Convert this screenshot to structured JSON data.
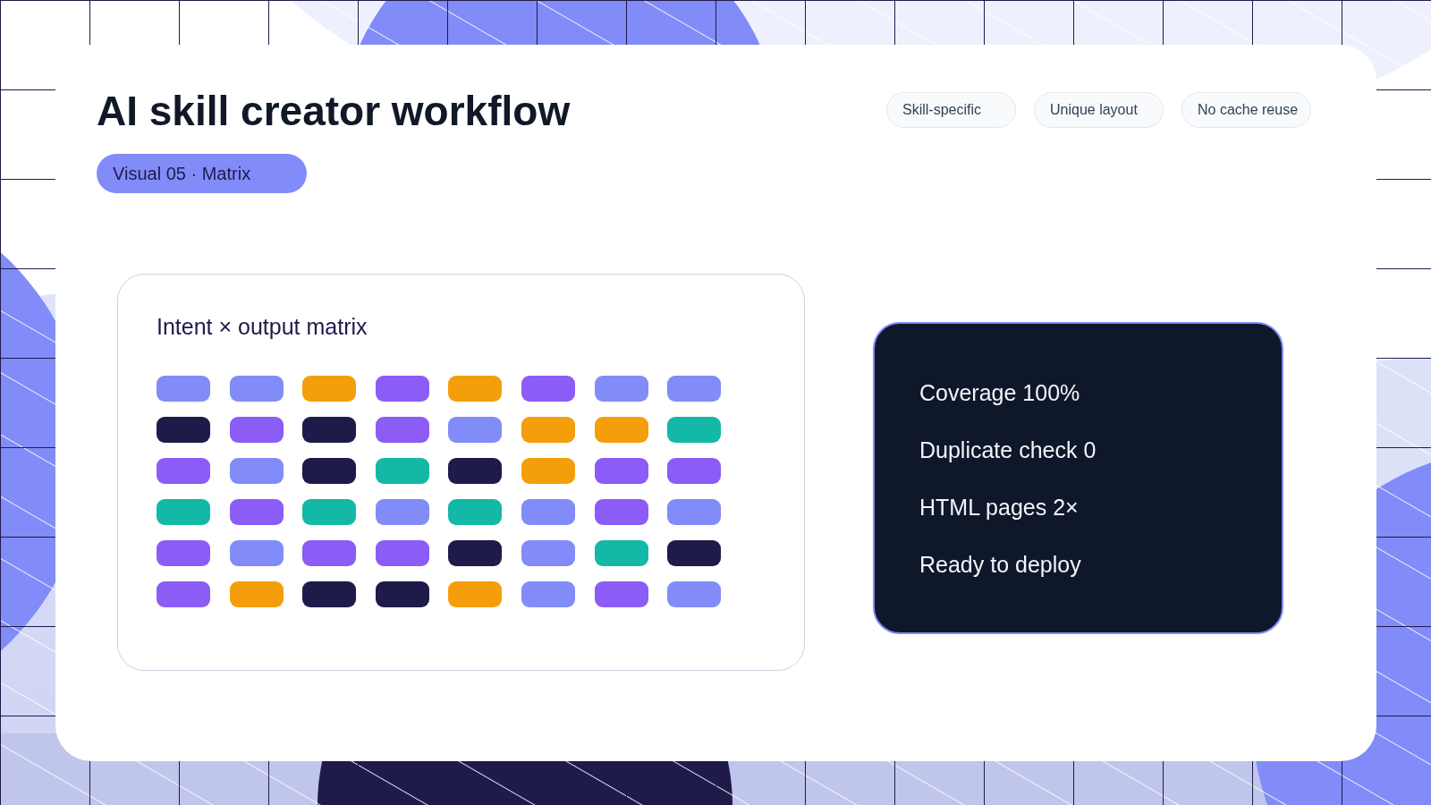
{
  "title": "AI skill creator workflow",
  "badge": "Visual 05 · Matrix",
  "tags": [
    "Skill-specific",
    "Unique layout",
    "No cache reuse"
  ],
  "matrix": {
    "title": "Intent × output matrix",
    "rows": [
      {
        "cells": [
          {
            "color": "#818cf8"
          },
          {
            "color": "#818cf8"
          },
          {
            "color": "#f59e0b"
          },
          {
            "color": "#8b5cf6"
          },
          {
            "color": "#f59e0b"
          },
          {
            "color": "#8b5cf6"
          },
          {
            "color": "#818cf8"
          },
          {
            "color": "#818cf8"
          }
        ]
      },
      {
        "cells": [
          {
            "color": "#1e1b4b"
          },
          {
            "color": "#8b5cf6"
          },
          {
            "color": "#1e1b4b"
          },
          {
            "color": "#8b5cf6"
          },
          {
            "color": "#818cf8"
          },
          {
            "color": "#f59e0b"
          },
          {
            "color": "#f59e0b"
          },
          {
            "color": "#14b8a6"
          }
        ]
      },
      {
        "cells": [
          {
            "color": "#8b5cf6"
          },
          {
            "color": "#818cf8"
          },
          {
            "color": "#1e1b4b"
          },
          {
            "color": "#14b8a6"
          },
          {
            "color": "#1e1b4b"
          },
          {
            "color": "#f59e0b"
          },
          {
            "color": "#8b5cf6"
          },
          {
            "color": "#8b5cf6"
          }
        ]
      },
      {
        "cells": [
          {
            "color": "#14b8a6"
          },
          {
            "color": "#8b5cf6"
          },
          {
            "color": "#14b8a6"
          },
          {
            "color": "#818cf8"
          },
          {
            "color": "#14b8a6"
          },
          {
            "color": "#818cf8"
          },
          {
            "color": "#8b5cf6"
          },
          {
            "color": "#818cf8"
          }
        ]
      },
      {
        "cells": [
          {
            "color": "#8b5cf6"
          },
          {
            "color": "#818cf8"
          },
          {
            "color": "#8b5cf6"
          },
          {
            "color": "#8b5cf6"
          },
          {
            "color": "#1e1b4b"
          },
          {
            "color": "#818cf8"
          },
          {
            "color": "#14b8a6"
          },
          {
            "color": "#1e1b4b"
          }
        ]
      },
      {
        "cells": [
          {
            "color": "#8b5cf6"
          },
          {
            "color": "#f59e0b"
          },
          {
            "color": "#1e1b4b"
          },
          {
            "color": "#1e1b4b"
          },
          {
            "color": "#f59e0b"
          },
          {
            "color": "#818cf8"
          },
          {
            "color": "#8b5cf6"
          },
          {
            "color": "#818cf8"
          }
        ]
      }
    ]
  },
  "summary": {
    "lines": [
      "Coverage 100%",
      "Duplicate check 0",
      "HTML pages 2×",
      "Ready to deploy"
    ]
  }
}
